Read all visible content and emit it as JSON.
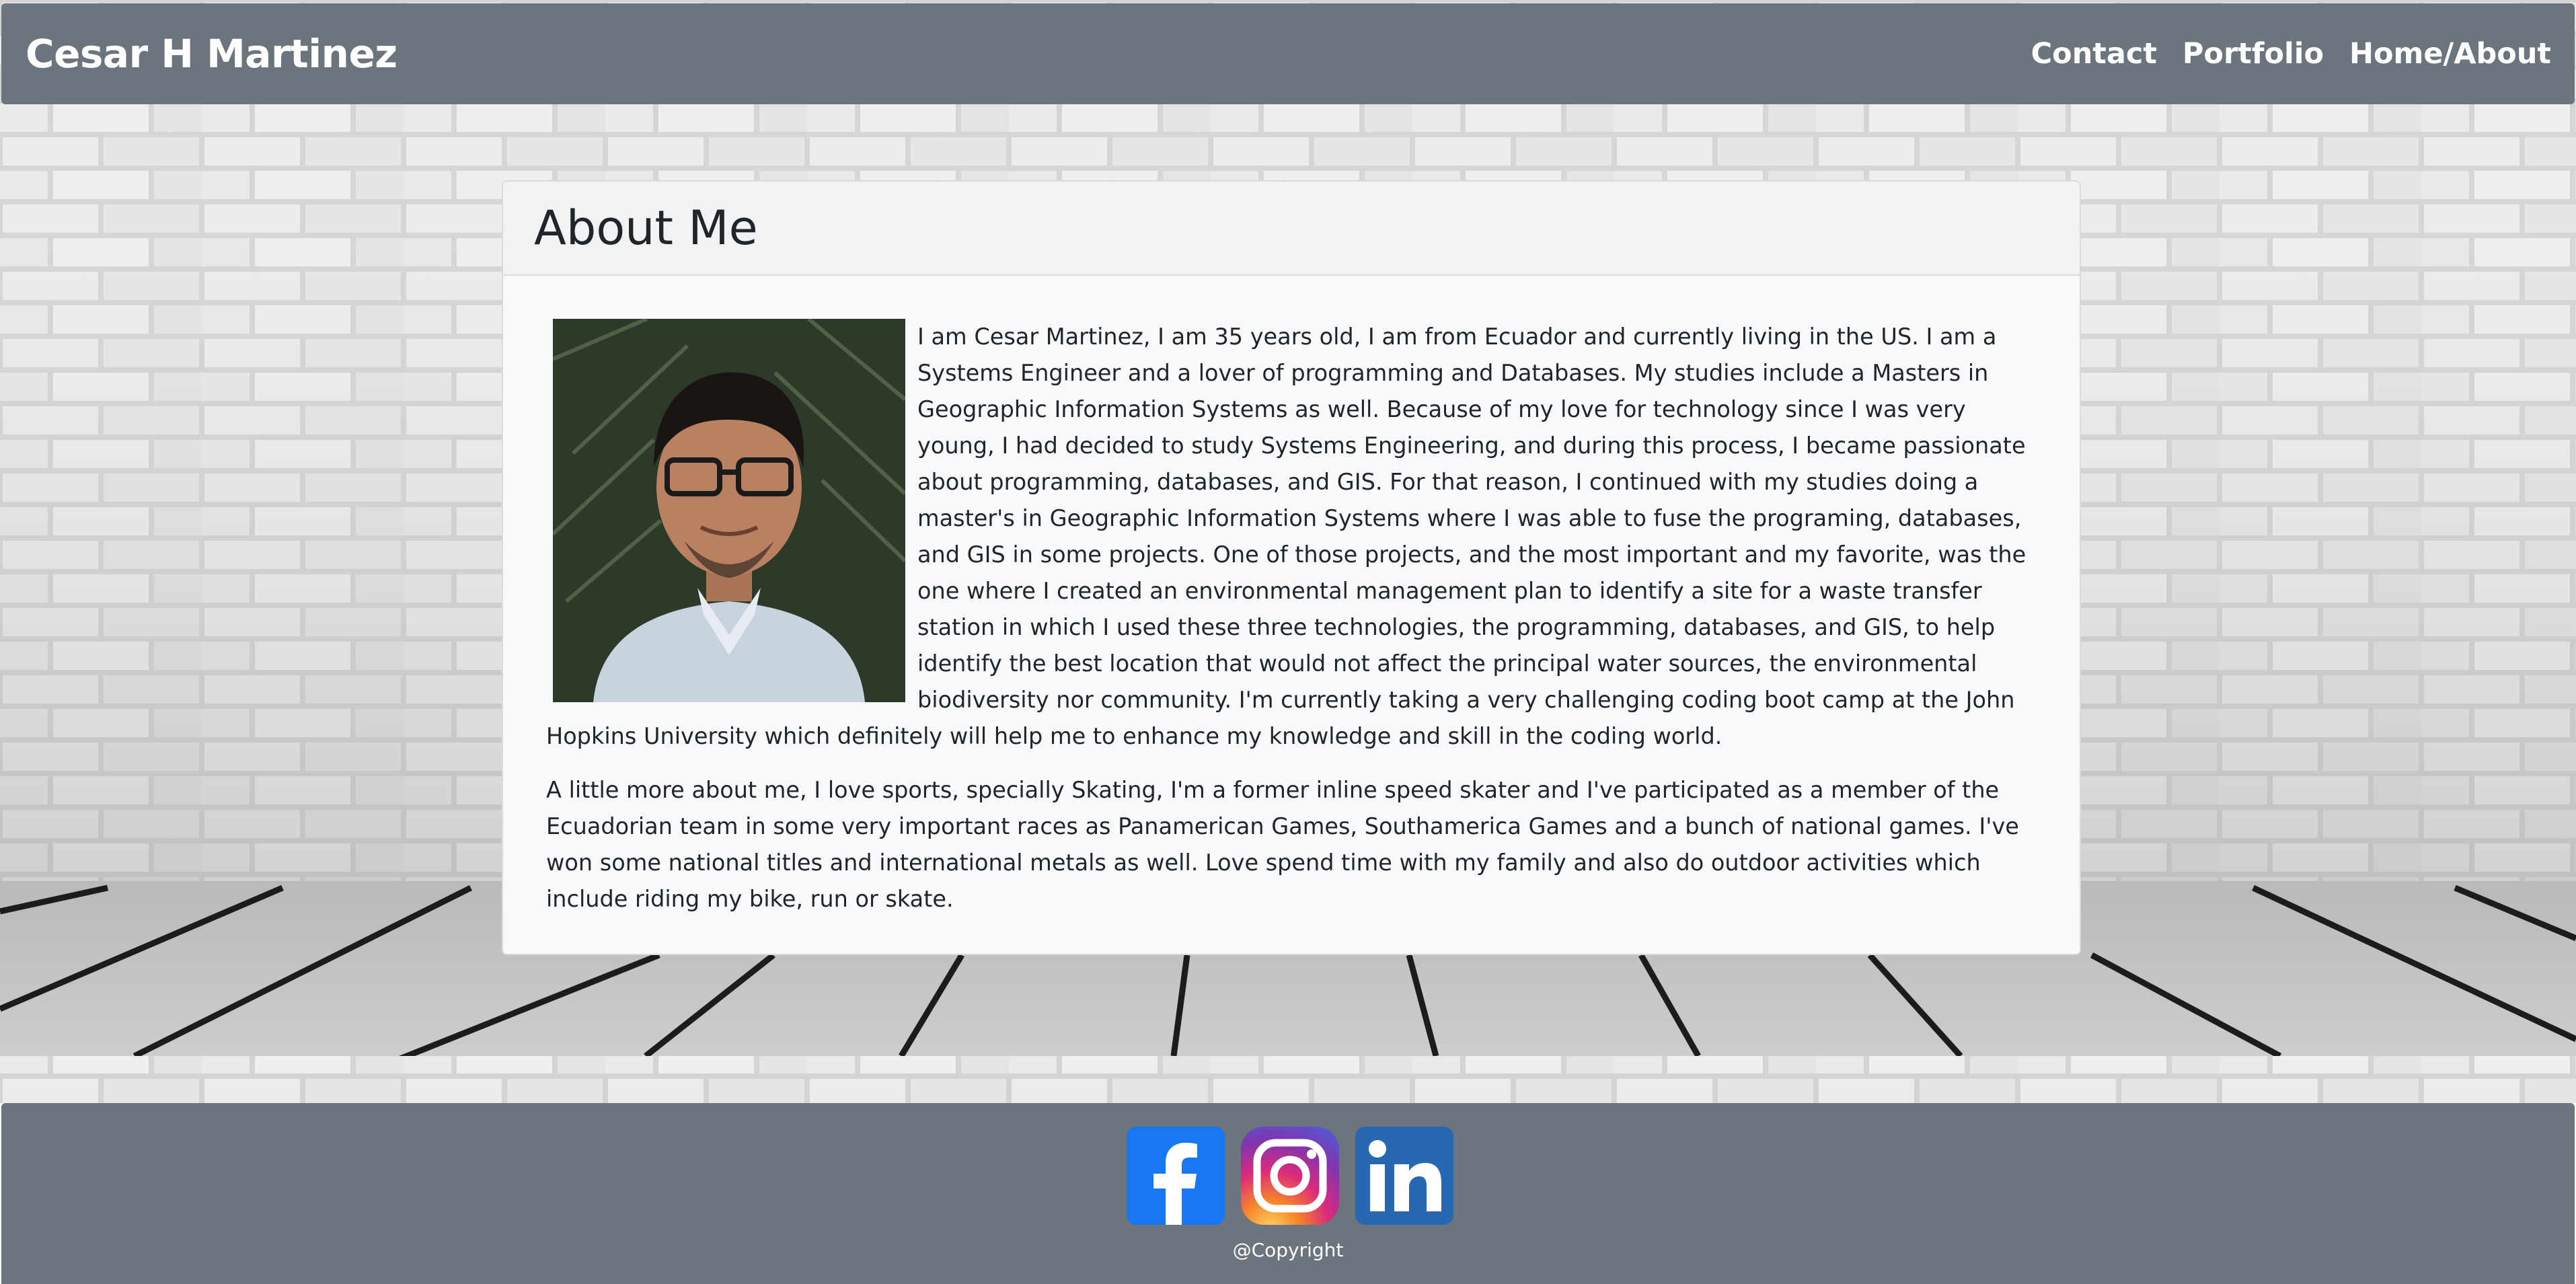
{
  "navbar": {
    "brand": "Cesar H Martinez",
    "links": [
      "Contact",
      "Portfolio",
      "Home/About"
    ]
  },
  "card": {
    "title": "About Me",
    "paragraphs": [
      "I am Cesar Martinez, I am 35 years old, I am from Ecuador and currently living in the US. I am a Systems Engineer and a lover of programming and Databases. My studies include a Masters in Geographic Information Systems as well. Because of my love for technology since I was very young, I had decided to study Systems Engineering, and during this process, I became passionate about programming, databases, and GIS. For that reason, I continued with my studies doing a master's in Geographic Information Systems where I was able to fuse the programing, databases, and GIS in some projects. One of those projects, and the most important and my favorite, was the one where I created an environmental management plan to identify a site for a waste transfer station in which I used these three technologies, the programming, databases, and GIS, to help identify the best location that would not affect the principal water sources, the environmental biodiversity nor community. I'm currently taking a very challenging coding boot camp at the John Hopkins University which definitely will help me to enhance my knowledge and skill in the coding world.",
      "A little more about me, I love sports, specially Skating, I'm a former inline speed skater and I've participated as a member of the Ecuadorian team in some very important races as Panamerican Games, Southamerica Games and a bunch of national games. I've won some national titles and international metals as well. Love spend time with my family and also do outdoor activities which include riding my bike, run or skate."
    ]
  },
  "footer": {
    "social_icons": [
      "facebook-icon",
      "instagram-icon",
      "linkedin-icon"
    ],
    "copyright": "@Copyright"
  },
  "colors": {
    "navbar": "#6c757d",
    "footer": "#6c757d",
    "card_background": "#f8f9fa",
    "facebook": "#1877f2",
    "linkedin": "#2867b2"
  }
}
